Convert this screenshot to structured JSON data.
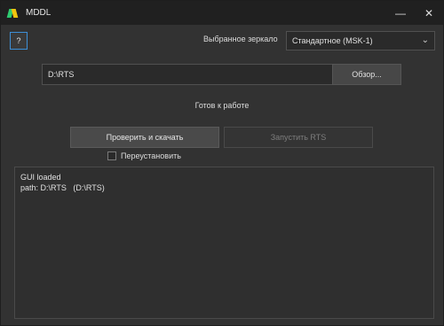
{
  "window": {
    "title": "MDDL",
    "controls": {
      "minimize": "—",
      "close": "✕"
    }
  },
  "help": {
    "label": "?"
  },
  "mirror": {
    "label": "Выбранное зеркало",
    "selected": "Стандартное (MSK-1)"
  },
  "path": {
    "value": "D:\\RTS",
    "browse_label": "Обзор..."
  },
  "status": "Готов к работе",
  "actions": {
    "check_label": "Проверить и скачать",
    "run_label": "Запустить RTS"
  },
  "reinstall": {
    "label": "Переустановить",
    "checked": false
  },
  "log": {
    "lines": [
      "GUI loaded",
      "path: D:\\RTS   (D:\\RTS)"
    ]
  },
  "colors": {
    "background": "#323232",
    "titlebar": "#202020",
    "focus_border": "#3d8fd6",
    "icon_green": "#2ecc71",
    "icon_yellow": "#f1c40f"
  },
  "icons": {
    "app": "mddl-logo-icon",
    "dropdown": "chevron-down-icon"
  }
}
